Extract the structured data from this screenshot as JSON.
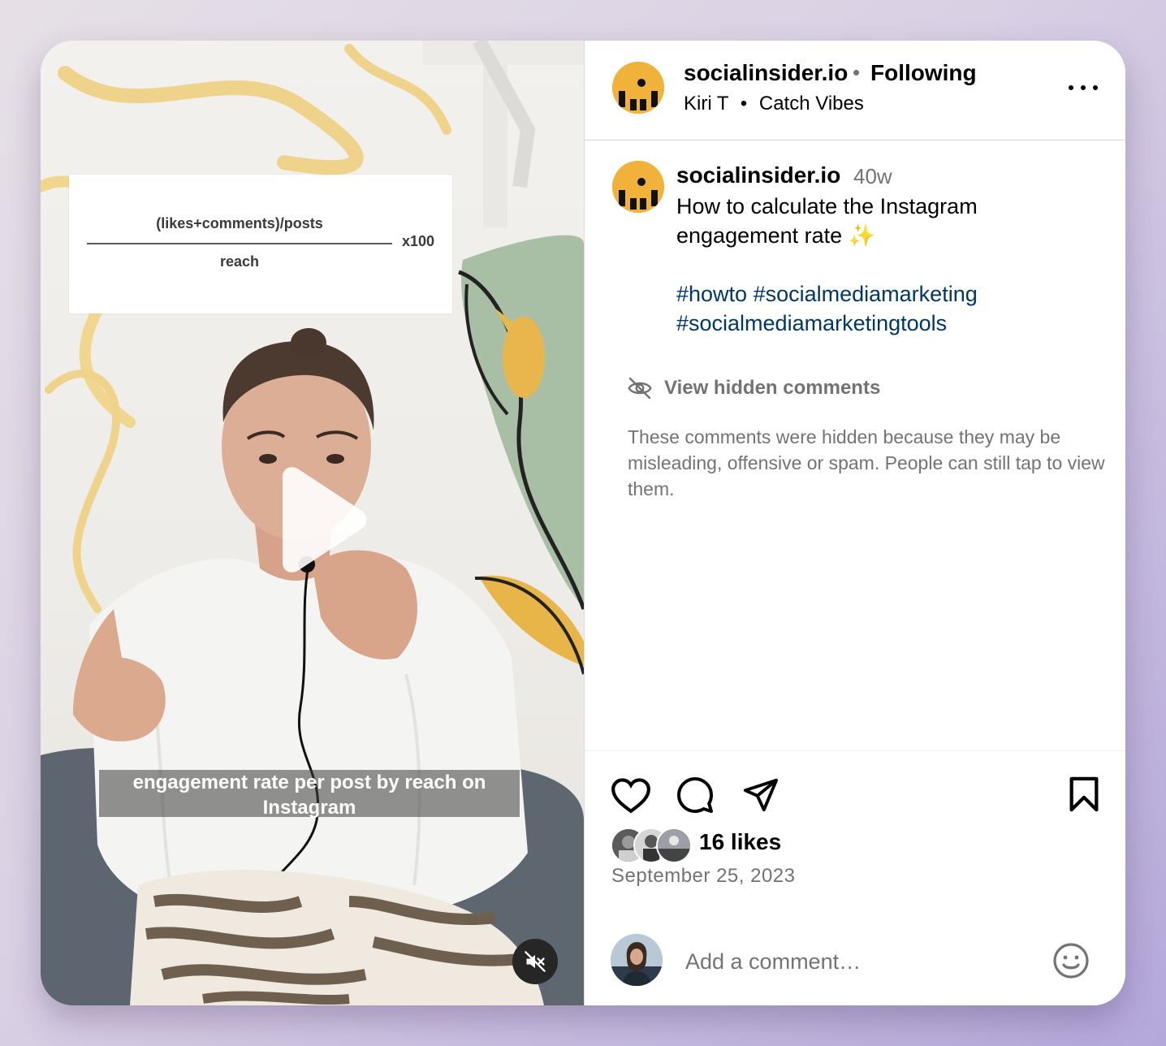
{
  "video": {
    "formula_numerator": "(likes+comments)/posts",
    "formula_denominator": "reach",
    "formula_multiplier": "x100",
    "caption": "engagement rate per post by reach on Instagram"
  },
  "header": {
    "username": "socialinsider.io",
    "separator": "•",
    "follow_status": "Following",
    "audio_artist": "Kiri T",
    "audio_separator": "•",
    "audio_title": "Catch Vibes"
  },
  "post": {
    "username": "socialinsider.io",
    "time_ago": "40w",
    "caption": "How to calculate the Instagram engagement rate ✨",
    "hashtags": [
      "#howto",
      "#socialmediamarketing",
      "#socialmediamarketingtools"
    ]
  },
  "hidden_comments": {
    "label": "View hidden comments",
    "description": "These comments were hidden because they may be misleading, offensive or spam. People can still tap to view them."
  },
  "engagement": {
    "likes": "16 likes",
    "date": "September 25, 2023"
  },
  "comment_box": {
    "placeholder": "Add a comment…"
  },
  "colors": {
    "brand_avatar": "#f0b23a",
    "hashtag": "#00376b",
    "muted_text": "#737373"
  }
}
